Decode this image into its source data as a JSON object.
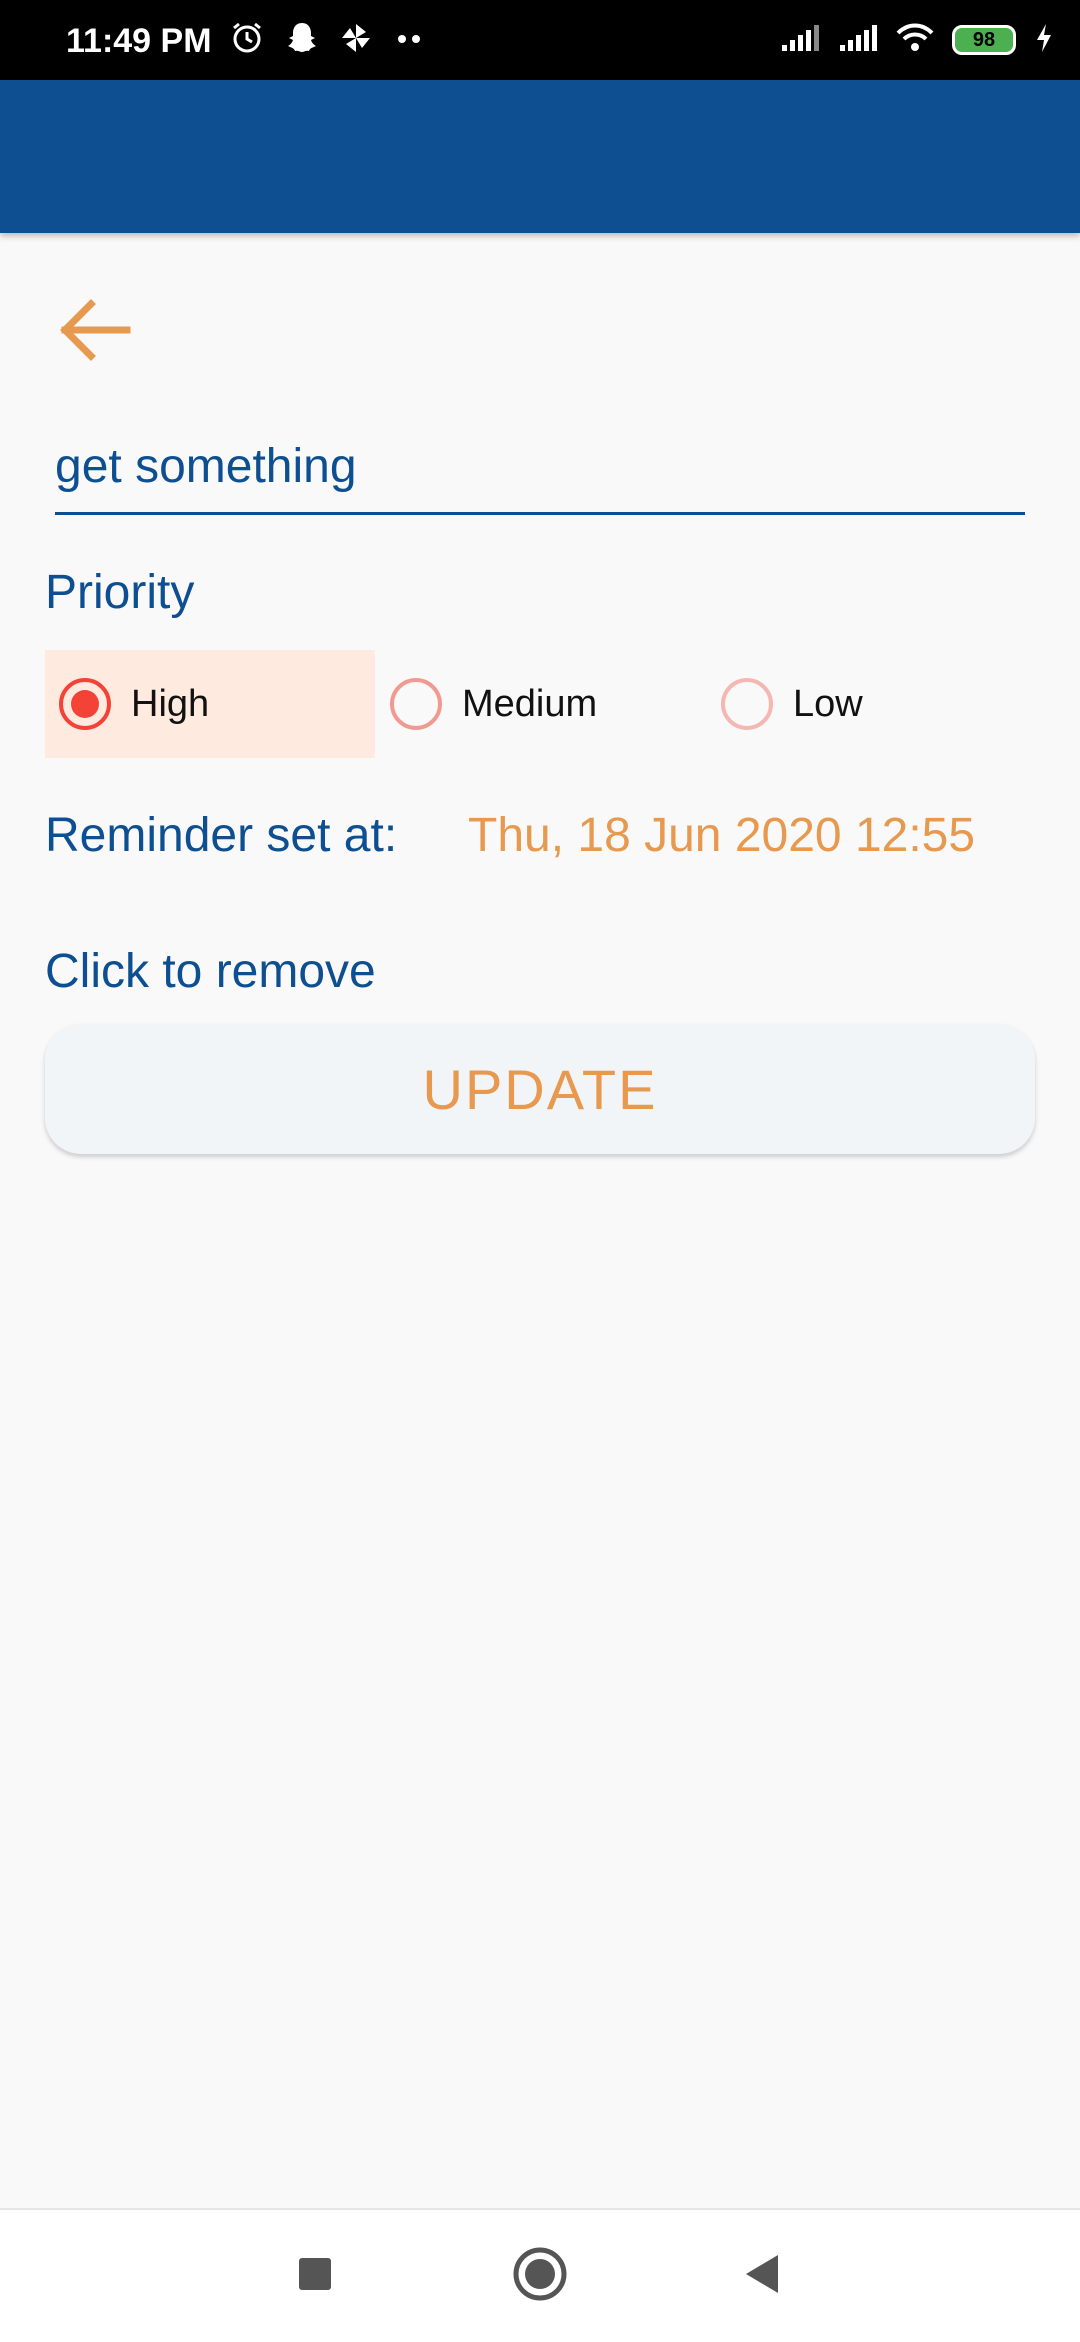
{
  "status_bar": {
    "time": "11:49 PM",
    "battery": "98",
    "icons_left": [
      "alarm-icon",
      "snapchat-icon",
      "pinwheel-icon",
      "more-dots-icon"
    ],
    "icons_right": [
      "signal-icon",
      "signal-icon",
      "wifi-icon",
      "battery-icon",
      "charging-icon"
    ]
  },
  "header": {
    "back_icon": "arrow-left-icon"
  },
  "task": {
    "title": "get something"
  },
  "priority": {
    "label": "Priority",
    "selected": "High",
    "options": [
      {
        "label": "High",
        "checked": true
      },
      {
        "label": "Medium",
        "checked": false
      },
      {
        "label": "Low",
        "checked": false
      }
    ]
  },
  "reminder": {
    "label": "Reminder set at:",
    "value": "Thu, 18 Jun 2020 12:55",
    "remove_label": "Click to remove"
  },
  "actions": {
    "update_label": "UPDATE"
  },
  "nav": {
    "items": [
      "recents-square-icon",
      "home-circle-icon",
      "back-triangle-icon"
    ]
  },
  "colors": {
    "app_bar": "#0e4f92",
    "accent_orange": "#e7994f",
    "text_blue": "#0e4f92",
    "radio_red": "#f44336",
    "selected_bg": "#ffeadf"
  }
}
